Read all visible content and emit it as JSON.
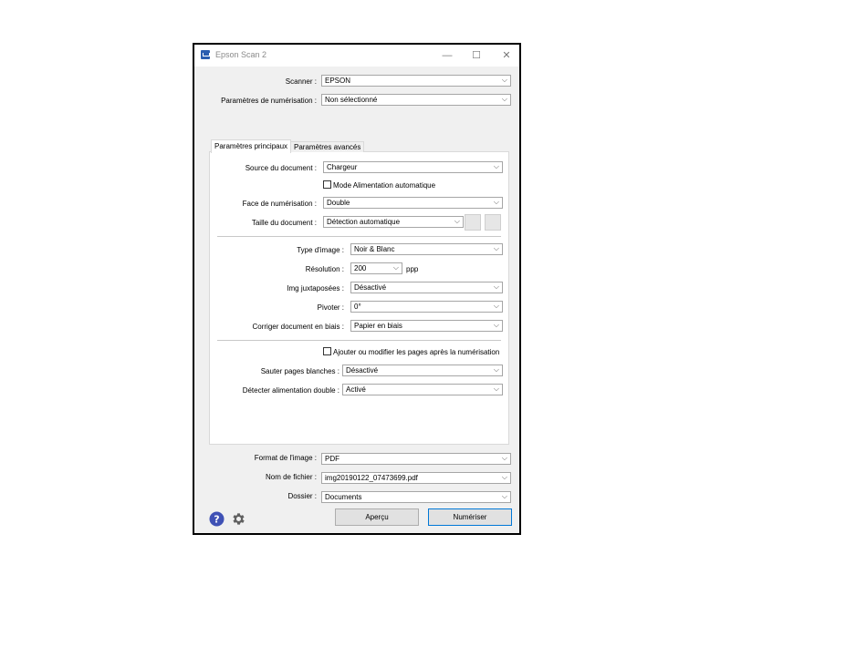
{
  "window": {
    "title": "Epson Scan 2",
    "minimize": "—",
    "maximize": "☐",
    "close": "✕"
  },
  "scanner": {
    "label": "Scanner :",
    "value": "EPSON"
  },
  "scan_settings": {
    "label": "Paramètres de numérisation :",
    "value": "Non sélectionné"
  },
  "tabs": [
    {
      "label": "Paramètres principaux",
      "active": true
    },
    {
      "label": "Paramètres avancés",
      "active": false
    }
  ],
  "main": {
    "document_source": {
      "label": "Source du document :",
      "value": "Chargeur"
    },
    "auto_feed_mode": {
      "label": "Mode Alimentation automatique",
      "checked": false
    },
    "scan_side": {
      "label": "Face de numérisation :",
      "value": "Double"
    },
    "document_size": {
      "label": "Taille du document :",
      "value": "Détection automatique"
    },
    "image_type": {
      "label": "Type d'image :",
      "value": "Noir & Blanc"
    },
    "resolution": {
      "label": "Résolution :",
      "value": "200",
      "unit": "ppp"
    },
    "stitch_images": {
      "label": "Img juxtaposées :",
      "value": "Désactivé"
    },
    "rotate": {
      "label": "Pivoter :",
      "value": "0°"
    },
    "correct_skew": {
      "label": "Corriger document en biais :",
      "value": "Papier en biais"
    },
    "add_edit_pages": {
      "label": "Ajouter ou modifier les pages après la numérisation",
      "checked": false
    },
    "skip_blank": {
      "label": "Sauter pages blanches :",
      "value": "Désactivé"
    },
    "double_feed": {
      "label": "Détecter alimentation double :",
      "value": "Activé"
    }
  },
  "output": {
    "image_format": {
      "label": "Format de l'image :",
      "value": "PDF"
    },
    "file_name": {
      "label": "Nom de fichier :",
      "value": "img20190122_07473699.pdf"
    },
    "folder": {
      "label": "Dossier :",
      "value": "Documents"
    }
  },
  "buttons": {
    "preview": "Aperçu",
    "scan": "Numériser"
  },
  "colors": {
    "help_icon": "#3f51b5",
    "primary_border": "#0078d7"
  }
}
